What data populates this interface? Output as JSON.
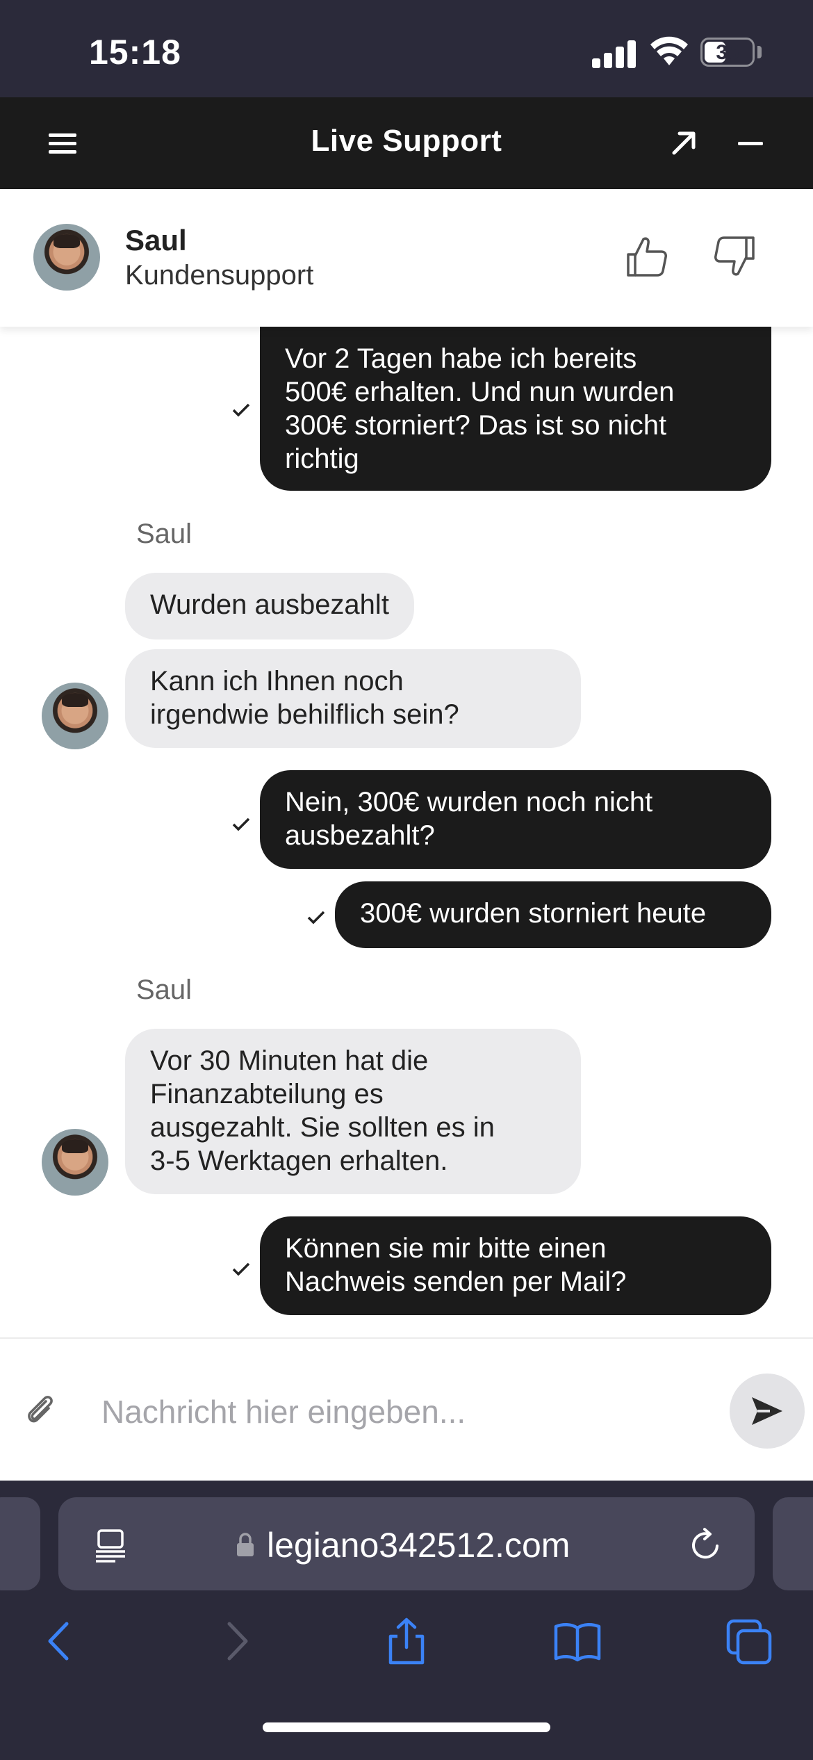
{
  "status_bar": {
    "time": "15:18",
    "battery": "35"
  },
  "header": {
    "title": "Live Support"
  },
  "agent": {
    "name": "Saul",
    "role": "Kundensupport"
  },
  "messages": [
    {
      "from": "user",
      "text": "Vor 2 Tagen habe ich bereits\n500€ erhalten. Und nun wurden\n300€ storniert? Das ist so nicht\nrichtig"
    },
    {
      "from": "agent",
      "sender": "Saul",
      "text": "Wurden ausbezahlt"
    },
    {
      "from": "agent",
      "text": "Kann ich Ihnen noch\nirgendwie behilflich sein?"
    },
    {
      "from": "user",
      "text": "Nein, 300€ wurden noch nicht\nausbezahlt?"
    },
    {
      "from": "user",
      "text": "300€ wurden storniert heute"
    },
    {
      "from": "agent",
      "sender": "Saul",
      "text": "Vor 30 Minuten hat die\nFinanzabteilung es\nausgezahlt. Sie sollten es in\n3-5 Werktagen erhalten."
    },
    {
      "from": "user",
      "text": "Können sie mir bitte einen\nNachweis senden per Mail?"
    }
  ],
  "composer": {
    "placeholder": "Nachricht hier eingeben...",
    "value": ""
  },
  "browser": {
    "url": "legiano342512.com"
  },
  "colors": {
    "header_bg": "#1b1b1b",
    "status_bg": "#2b2a3a",
    "user_bubble": "#1b1b1b",
    "agent_bubble": "#ebebed",
    "accent": "#3b82f6"
  },
  "icons": [
    "menu-icon",
    "expand-icon",
    "minimize-icon",
    "thumbs-up-icon",
    "thumbs-down-icon",
    "checkmark-icon",
    "paperclip-icon",
    "send-icon",
    "reader-icon",
    "lock-icon",
    "reload-icon",
    "back-icon",
    "forward-icon",
    "share-icon",
    "bookmarks-icon",
    "tabs-icon"
  ]
}
